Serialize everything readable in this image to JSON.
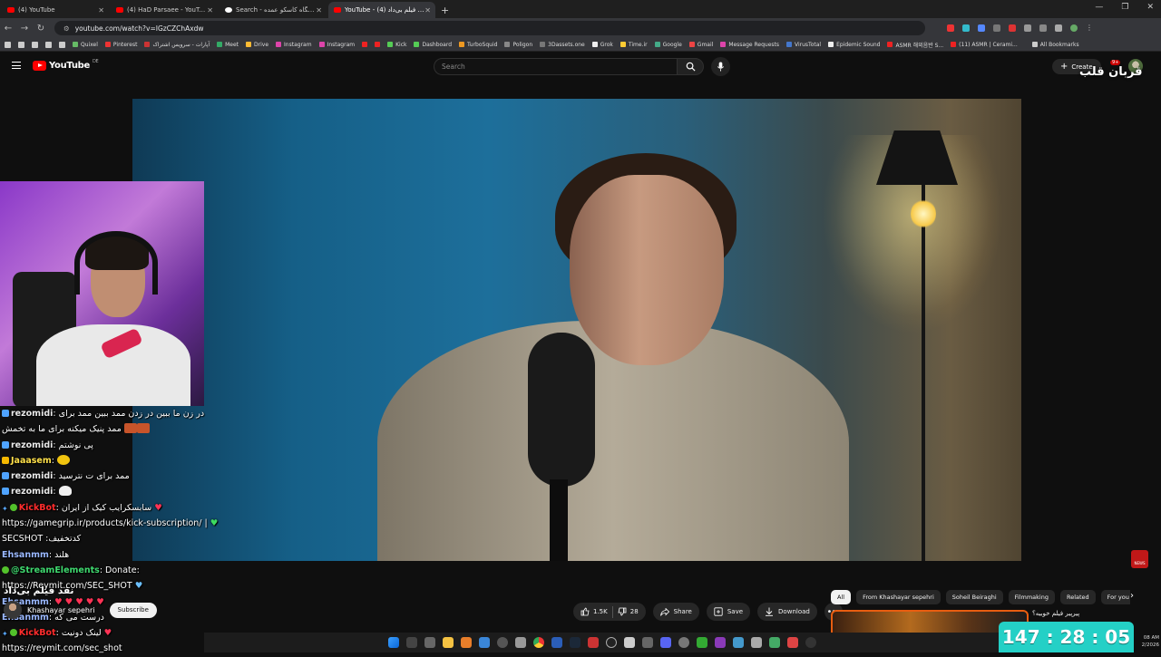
{
  "browser": {
    "tabs": [
      {
        "label": "(4) YouTube",
        "icon": "youtube-icon",
        "active": false
      },
      {
        "label": "(4) HaD Parsaee - YouTube",
        "icon": "youtube-icon",
        "active": false
      },
      {
        "label": "Search - فروشگاه کاسکو عمده",
        "icon": "google-icon",
        "active": false
      },
      {
        "label": "YouTube - نقد فیلم بی‌داد (4)",
        "icon": "youtube-icon",
        "active": true
      }
    ],
    "new_tab": "+",
    "url": "youtube.com/watch?v=IGzCZChAxdw",
    "bookmarks": [
      "Quixel",
      "Pinterest",
      "آپارات - سرویس اشتراک",
      "Meet",
      "Drive",
      "Instagram",
      "Instagram",
      "Kick",
      "Dashboard",
      "TurboSquid",
      "Poligon",
      "3Dassets.one",
      "Grok",
      "Time.ir",
      "Google",
      "Gmail",
      "Message Requests",
      "VirusTotal",
      "Epidemic Sound",
      "ASMR 해외음반 S...",
      "(11) ASMR | Cerami..."
    ],
    "all_bookmarks": "All Bookmarks"
  },
  "youtube": {
    "logo_text": "YouTube",
    "region": "DE",
    "search_placeholder": "Search",
    "create_label": "Create",
    "notification_count": "9+",
    "overlay_title": "قربان قلب"
  },
  "video": {
    "title": "نقد فیلم بی‌داد",
    "channel_name": "Khashayar sepehri",
    "subscribe_label": "Subscribe",
    "likes": "1.5K",
    "dislikes": "28",
    "share_label": "Share",
    "save_label": "Save",
    "download_label": "Download"
  },
  "chips": [
    "All",
    "From Khashayar sepehri",
    "Soheil Beiraghi",
    "Filmmaking",
    "Related",
    "For you",
    "R"
  ],
  "recommendation": {
    "title": "پیرپیر فیلم خوبیه؟"
  },
  "chat": [
    {
      "badge": "shield",
      "user": "rezomidi",
      "user_color": "white",
      "text": "در زن ما ببین در زدن ممد ببین ممد برای",
      "extra": ""
    },
    {
      "badge": "",
      "user": "",
      "user_color": "white",
      "text": "ممد پنیک میکنه برای ما به تخمش",
      "extra": "emote2"
    },
    {
      "badge": "shield",
      "user": "rezomidi",
      "user_color": "white",
      "text": "پی نوشتم",
      "extra": ""
    },
    {
      "badge": "crown",
      "user": "Jaaasem",
      "user_color": "yellow",
      "text": "",
      "extra": "emote-yellow"
    },
    {
      "badge": "shield",
      "user": "rezomidi",
      "user_color": "white",
      "text": "ممد برای ت نترسید",
      "extra": ""
    },
    {
      "badge": "shield",
      "user": "rezomidi",
      "user_color": "white",
      "text": "",
      "extra": "emote-white"
    },
    {
      "badge": "bot",
      "user": "KickBot",
      "user_color": "red",
      "text": "سابسکرایب کیک از ایران",
      "extra": "heart"
    },
    {
      "badge": "",
      "user": "",
      "user_color": "white",
      "text": "https://gamegrip.ir/products/kick-subscription/ |",
      "extra": "heart-green"
    },
    {
      "badge": "",
      "user": "",
      "user_color": "white",
      "text": "کدتخفیف: SECSHOT",
      "extra": ""
    },
    {
      "badge": "",
      "user": "Ehsanmm",
      "user_color": "blue",
      "text": "هلند",
      "extra": ""
    },
    {
      "badge": "green",
      "user": "@StreamElements",
      "user_color": "green",
      "text": "Donate:",
      "extra": ""
    },
    {
      "badge": "",
      "user": "",
      "user_color": "white",
      "text": "https://Reymit.com/SEC_SHOT",
      "extra": "heart-blue"
    },
    {
      "badge": "",
      "user": "Ehsanmm",
      "user_color": "blue",
      "text": "",
      "extra": "hearts"
    },
    {
      "badge": "",
      "user": "Ehsanmm",
      "user_color": "blue",
      "text": "درست می که",
      "extra": ""
    },
    {
      "badge": "bot",
      "user": "KickBot",
      "user_color": "red",
      "text": "لینک دونیت",
      "extra": "heart"
    },
    {
      "badge": "",
      "user": "",
      "user_color": "white",
      "text": "https://reymit.com/sec_shot",
      "extra": ""
    }
  ],
  "stream_timer": "147 : 28 : 05",
  "tray": {
    "time": "08 AM",
    "date": "2/2026"
  },
  "channel_logo_text": "NEWS"
}
